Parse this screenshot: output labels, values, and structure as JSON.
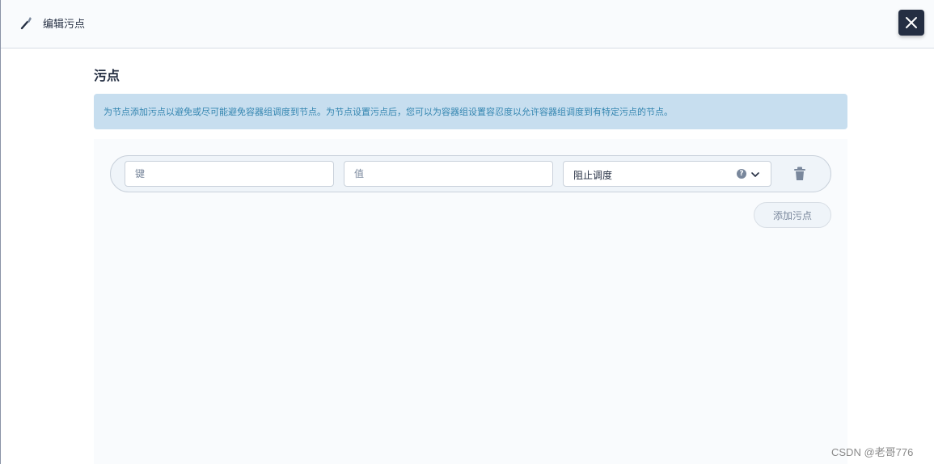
{
  "header": {
    "title": "编辑污点",
    "icon": "wrench-icon",
    "close_icon": "close-icon"
  },
  "section": {
    "title": "污点",
    "info": "为节点添加污点以避免或尽可能避免容器组调度到节点。为节点设置污点后，您可以为容器组设置容忍度以允许容器组调度到有特定污点的节点。"
  },
  "taints": [
    {
      "key_placeholder": "键",
      "value_placeholder": "值",
      "effect": "阻止调度",
      "help_symbol": "?"
    }
  ],
  "add_button": "添加污点",
  "watermark": "CSDN @老哥776",
  "colors": {
    "dark": "#242e42",
    "info_bg": "#c7deef",
    "info_text": "#3385b0",
    "panel_bg": "#f9fbfd"
  }
}
